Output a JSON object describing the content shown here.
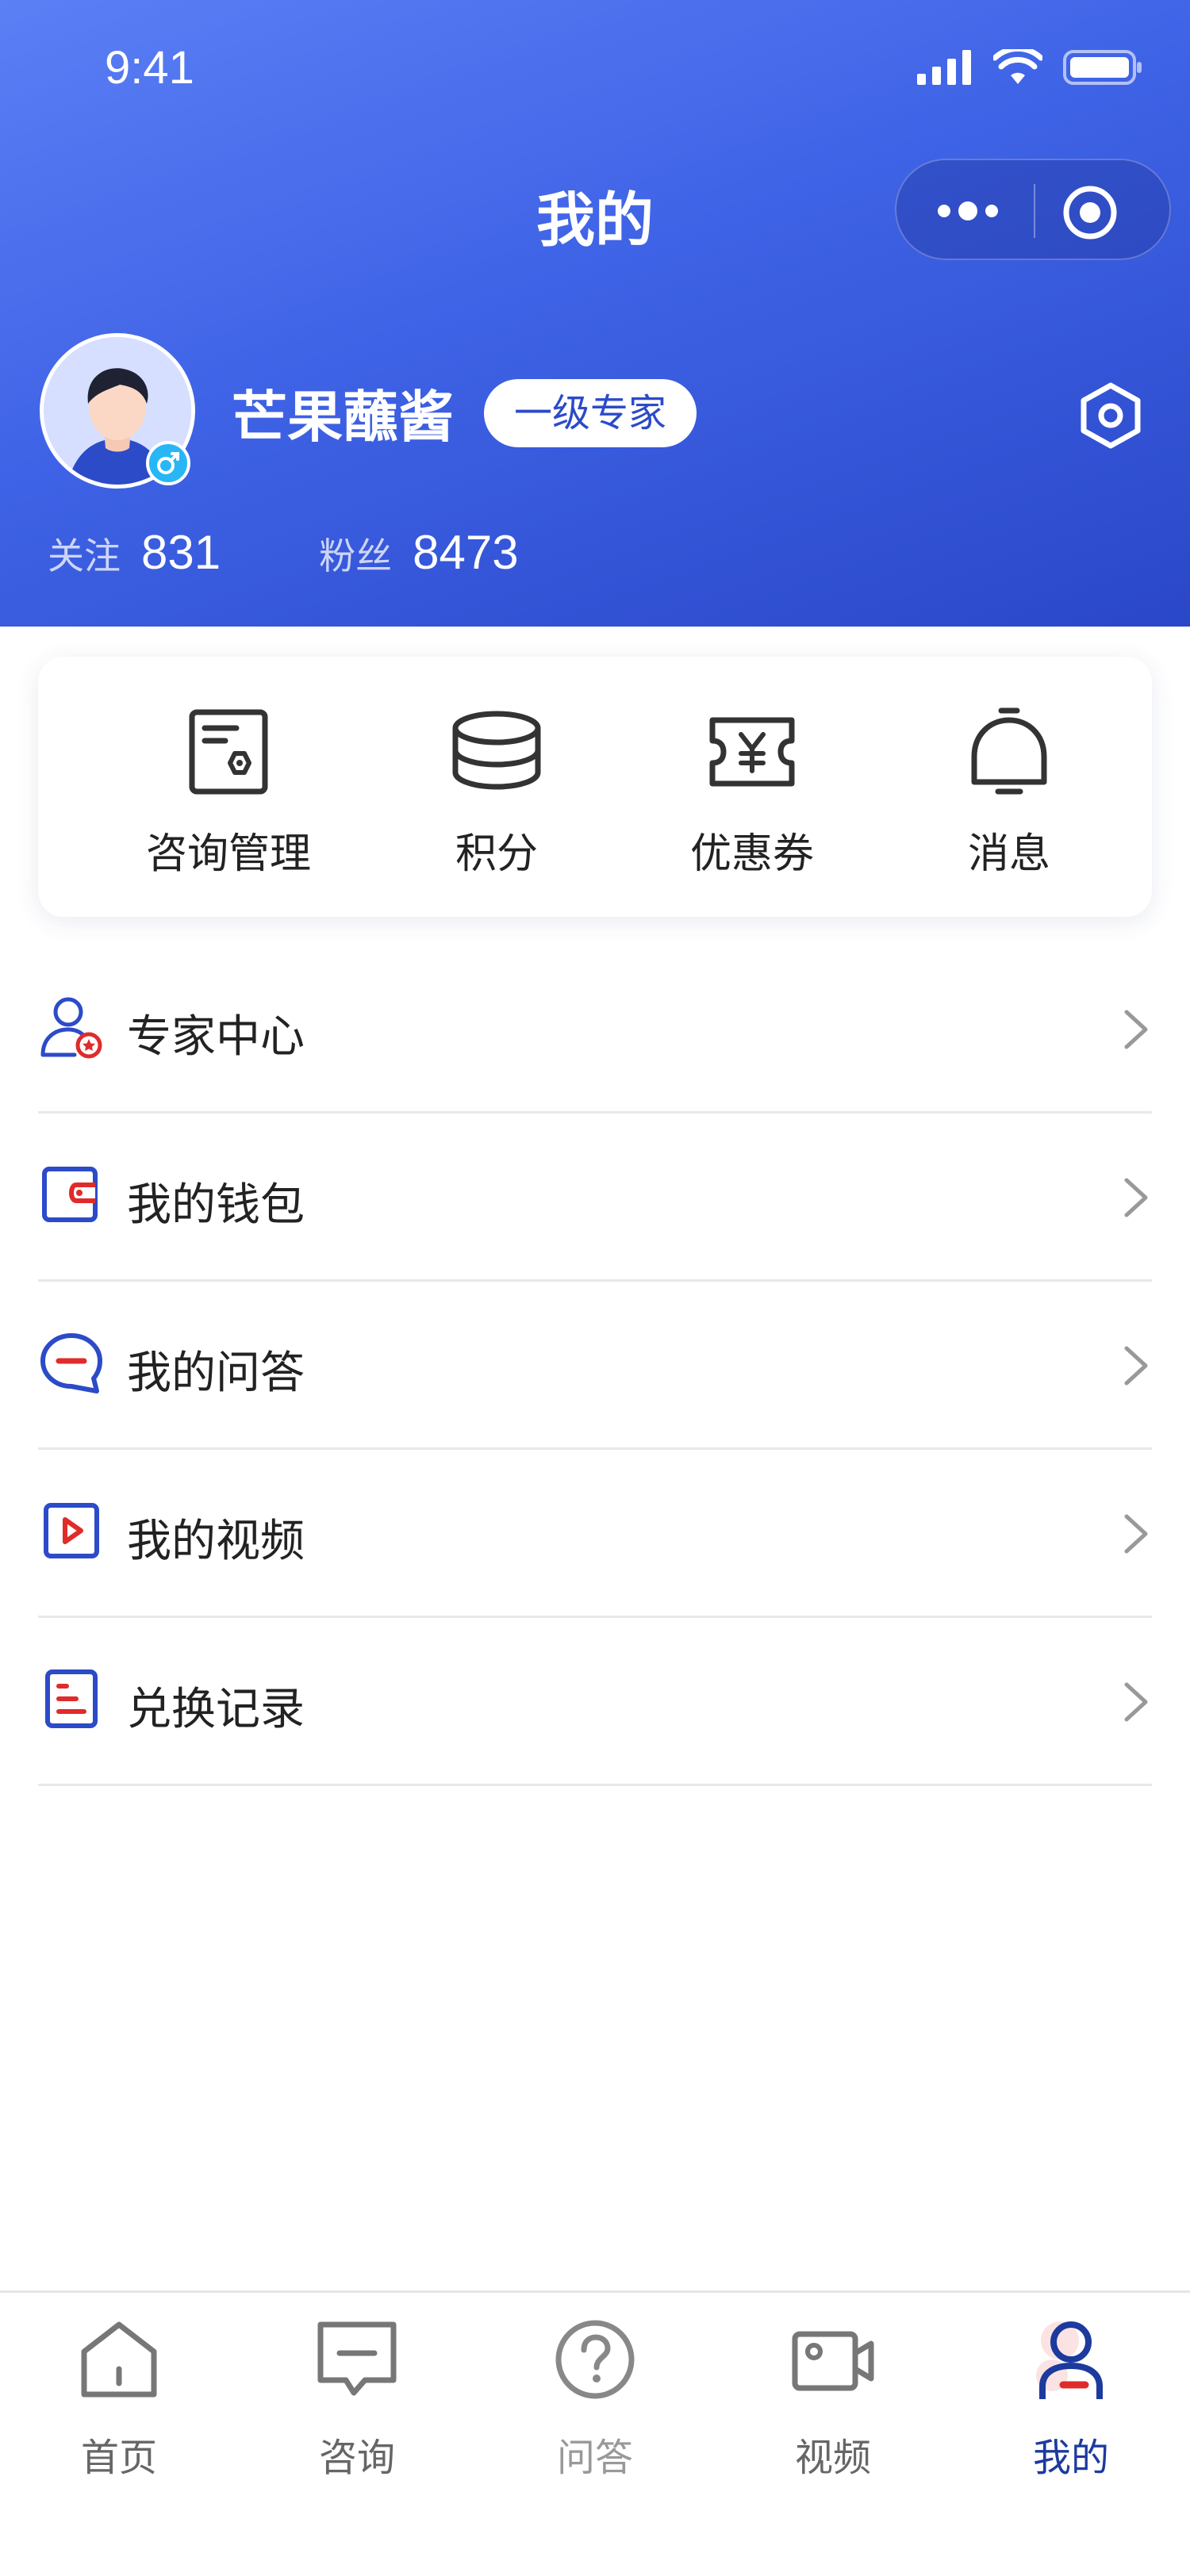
{
  "status_bar": {
    "time": "9:41"
  },
  "nav": {
    "title": "我的"
  },
  "profile": {
    "username": "芒果蘸酱",
    "level": "一级专家",
    "following_label": "关注",
    "following_count": "831",
    "followers_label": "粉丝",
    "followers_count": "8473"
  },
  "quick_actions": [
    {
      "label": "咨询管理",
      "icon": "consult-manage-icon"
    },
    {
      "label": "积分",
      "icon": "points-icon"
    },
    {
      "label": "优惠券",
      "icon": "coupon-icon"
    },
    {
      "label": "消息",
      "icon": "bell-icon"
    }
  ],
  "menu": [
    {
      "label": "专家中心",
      "icon": "expert-center-icon"
    },
    {
      "label": "我的钱包",
      "icon": "wallet-icon"
    },
    {
      "label": "我的问答",
      "icon": "qa-bubble-icon"
    },
    {
      "label": "我的视频",
      "icon": "video-play-icon"
    },
    {
      "label": "兑换记录",
      "icon": "record-list-icon"
    }
  ],
  "tabbar": [
    {
      "label": "首页",
      "icon": "home-icon"
    },
    {
      "label": "咨询",
      "icon": "chat-icon"
    },
    {
      "label": "问答",
      "icon": "question-icon"
    },
    {
      "label": "视频",
      "icon": "video-camera-icon"
    },
    {
      "label": "我的",
      "icon": "user-icon",
      "active": true
    }
  ],
  "colors": {
    "brand": "#2c4bc8",
    "accent_red": "#e02b2b",
    "active_tab": "#1d3a9e"
  }
}
